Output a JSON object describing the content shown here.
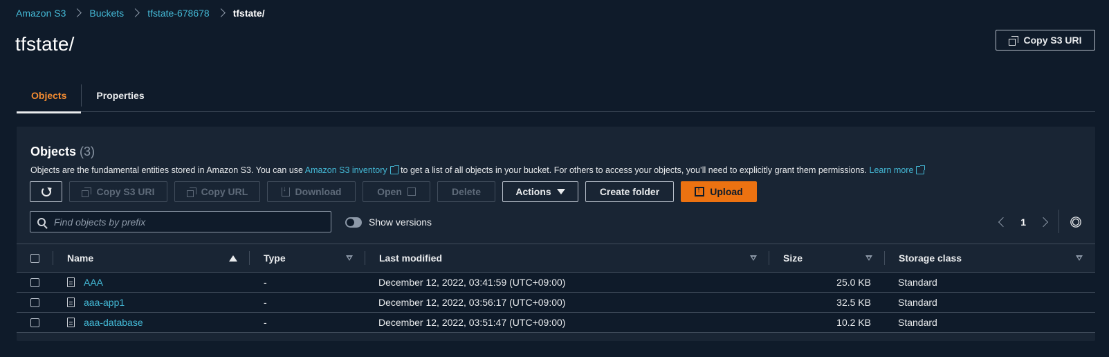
{
  "breadcrumb": [
    "Amazon S3",
    "Buckets",
    "tfstate-678678",
    "tfstate/"
  ],
  "page_title": "tfstate/",
  "header": {
    "copy_uri_label": "Copy S3 URI"
  },
  "tabs": [
    {
      "label": "Objects",
      "active": true
    },
    {
      "label": "Properties",
      "active": false
    }
  ],
  "panel": {
    "title": "Objects",
    "count": "(3)",
    "desc_part1": "Objects are the fundamental entities stored in Amazon S3. You can use ",
    "desc_link1": "Amazon S3 inventory",
    "desc_part2": " to get a list of all objects in your bucket. For others to access your objects, you’ll need to explicitly grant them permissions.",
    "desc_link2": "Learn more"
  },
  "toolbar": {
    "copy_s3_uri": "Copy S3 URI",
    "copy_url": "Copy URL",
    "download": "Download",
    "open": "Open",
    "delete": "Delete",
    "actions": "Actions",
    "create_folder": "Create folder",
    "upload": "Upload"
  },
  "search": {
    "placeholder": "Find objects by prefix",
    "value": ""
  },
  "show_versions": {
    "label": "Show versions",
    "on": false
  },
  "pagination": {
    "page": "1"
  },
  "table": {
    "columns": [
      "Name",
      "Type",
      "Last modified",
      "Size",
      "Storage class"
    ],
    "rows": [
      {
        "name": "AAA",
        "type": "-",
        "modified": "December 12, 2022, 03:41:59 (UTC+09:00)",
        "size": "25.0 KB",
        "storage": "Standard"
      },
      {
        "name": "aaa-app1",
        "type": "-",
        "modified": "December 12, 2022, 03:56:17 (UTC+09:00)",
        "size": "32.5 KB",
        "storage": "Standard"
      },
      {
        "name": "aaa-database",
        "type": "-",
        "modified": "December 12, 2022, 03:51:47 (UTC+09:00)",
        "size": "10.2 KB",
        "storage": "Standard"
      }
    ]
  },
  "colors": {
    "accent": "#ec7211",
    "link": "#44b9d6",
    "active_tab": "#f28b31",
    "background": "#0f1b2a",
    "panel": "#192534"
  },
  "icons": [
    "chevron-right-icon",
    "copy-icon",
    "refresh-icon",
    "download-icon",
    "external-link-icon",
    "caret-down-icon",
    "upload-icon",
    "search-icon",
    "chevron-left-icon",
    "gear-icon",
    "sort-ascending-icon",
    "sort-icon",
    "file-icon"
  ]
}
